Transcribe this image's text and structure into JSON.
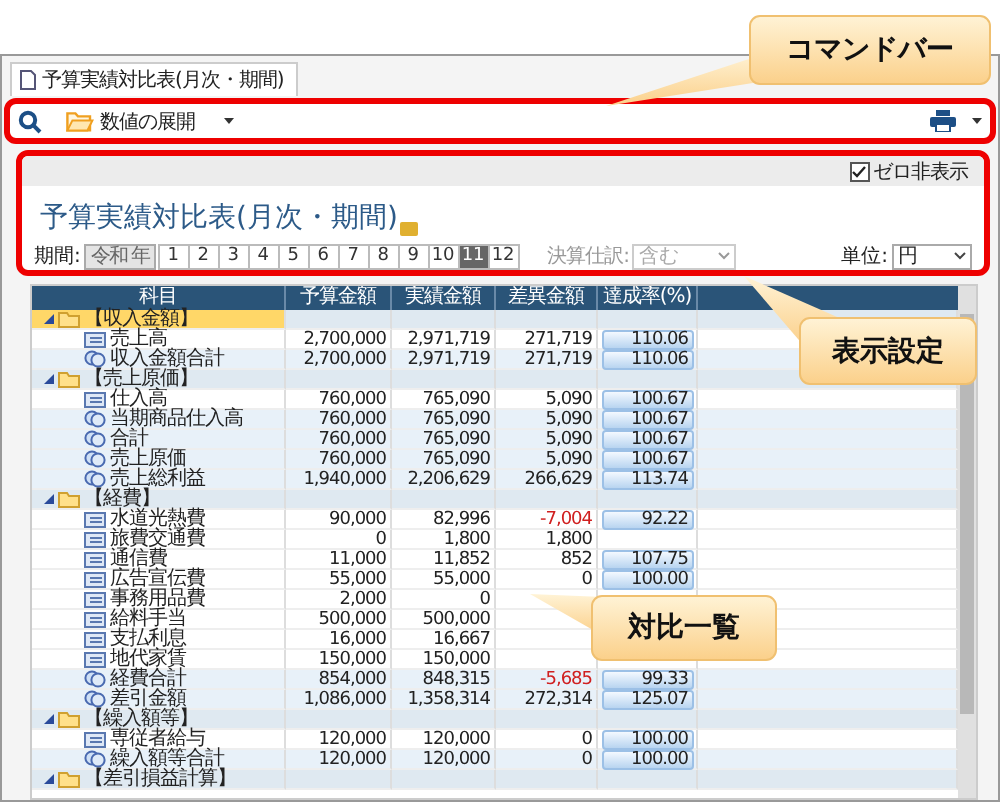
{
  "tab": {
    "label": "予算実績対比表(月次・期間)"
  },
  "command_bar": {
    "expand_button": "数値の展開"
  },
  "settings": {
    "zero_hide": {
      "label": "ゼロ非表示",
      "checked": true
    },
    "title": "予算実績対比表(月次・期間)",
    "period": {
      "label": "期間:",
      "year": "令和 年",
      "months": [
        {
          "label": "1",
          "selected": false
        },
        {
          "label": "2",
          "selected": false
        },
        {
          "label": "3",
          "selected": false
        },
        {
          "label": "4",
          "selected": false
        },
        {
          "label": "5",
          "selected": false
        },
        {
          "label": "6",
          "selected": false
        },
        {
          "label": "7",
          "selected": false
        },
        {
          "label": "8",
          "selected": false
        },
        {
          "label": "9",
          "selected": false
        },
        {
          "label": "10",
          "selected": false
        },
        {
          "label": "11",
          "selected": true
        },
        {
          "label": "12",
          "selected": false
        }
      ]
    },
    "closing": {
      "label": "決算仕訳:",
      "value": "含む",
      "disabled": true
    },
    "unit": {
      "label": "単位:",
      "value": "円"
    }
  },
  "table": {
    "columns": [
      "科目",
      "予算金額",
      "実績金額",
      "差異金額",
      "達成率(%)"
    ],
    "rows": [
      {
        "name": "【収入金額】",
        "kind": "group",
        "expanded": true,
        "selected": true
      },
      {
        "name": "売上高",
        "kind": "leaf",
        "selected": false,
        "budget": "2,700,000",
        "actual": "2,971,719",
        "diff": "271,719",
        "negative": false,
        "rate": "110.06"
      },
      {
        "name": "収入金額合計",
        "kind": "total",
        "selected": false,
        "budget": "2,700,000",
        "actual": "2,971,719",
        "diff": "271,719",
        "negative": false,
        "rate": "110.06"
      },
      {
        "name": "【売上原価】",
        "kind": "group",
        "expanded": true,
        "selected": false
      },
      {
        "name": "仕入高",
        "kind": "leaf",
        "selected": false,
        "budget": "760,000",
        "actual": "765,090",
        "diff": "5,090",
        "negative": false,
        "rate": "100.67"
      },
      {
        "name": "当期商品仕入高",
        "kind": "total",
        "selected": false,
        "budget": "760,000",
        "actual": "765,090",
        "diff": "5,090",
        "negative": false,
        "rate": "100.67"
      },
      {
        "name": "合計",
        "kind": "total",
        "selected": false,
        "budget": "760,000",
        "actual": "765,090",
        "diff": "5,090",
        "negative": false,
        "rate": "100.67"
      },
      {
        "name": "売上原価",
        "kind": "total",
        "selected": false,
        "budget": "760,000",
        "actual": "765,090",
        "diff": "5,090",
        "negative": false,
        "rate": "100.67"
      },
      {
        "name": "売上総利益",
        "kind": "total",
        "selected": false,
        "budget": "1,940,000",
        "actual": "2,206,629",
        "diff": "266,629",
        "negative": false,
        "rate": "113.74"
      },
      {
        "name": "【経費】",
        "kind": "group",
        "expanded": true,
        "selected": false
      },
      {
        "name": "水道光熱費",
        "kind": "leaf",
        "selected": false,
        "budget": "90,000",
        "actual": "82,996",
        "diff": "-7,004",
        "negative": true,
        "rate": "92.22"
      },
      {
        "name": "旅費交通費",
        "kind": "leaf",
        "selected": false,
        "budget": "0",
        "actual": "1,800",
        "diff": "1,800",
        "negative": false
      },
      {
        "name": "通信費",
        "kind": "leaf",
        "selected": false,
        "budget": "11,000",
        "actual": "11,852",
        "diff": "852",
        "negative": false,
        "rate": "107.75"
      },
      {
        "name": "広告宣伝費",
        "kind": "leaf",
        "selected": false,
        "budget": "55,000",
        "actual": "55,000",
        "diff": "0",
        "negative": false,
        "rate": "100.00"
      },
      {
        "name": "事務用品費",
        "kind": "leaf",
        "selected": false,
        "budget": "2,000",
        "actual": "0"
      },
      {
        "name": "給料手当",
        "kind": "leaf",
        "selected": false,
        "budget": "500,000",
        "actual": "500,000"
      },
      {
        "name": "支払利息",
        "kind": "leaf",
        "selected": false,
        "budget": "16,000",
        "actual": "16,667"
      },
      {
        "name": "地代家賃",
        "kind": "leaf",
        "selected": false,
        "budget": "150,000",
        "actual": "150,000"
      },
      {
        "name": "経費合計",
        "kind": "total",
        "selected": false,
        "budget": "854,000",
        "actual": "848,315",
        "diff": "-5,685",
        "negative": true,
        "rate": "99.33"
      },
      {
        "name": "差引金額",
        "kind": "total",
        "selected": false,
        "budget": "1,086,000",
        "actual": "1,358,314",
        "diff": "272,314",
        "negative": false,
        "rate": "125.07"
      },
      {
        "name": "【繰入額等】",
        "kind": "group",
        "expanded": true,
        "selected": false
      },
      {
        "name": "専従者給与",
        "kind": "leaf",
        "selected": false,
        "budget": "120,000",
        "actual": "120,000",
        "diff": "0",
        "negative": false,
        "rate": "100.00"
      },
      {
        "name": "繰入額等合計",
        "kind": "total",
        "selected": false,
        "budget": "120,000",
        "actual": "120,000",
        "diff": "0",
        "negative": false,
        "rate": "100.00"
      },
      {
        "name": "【差引損益計算】",
        "kind": "group",
        "expanded": true,
        "selected": false
      }
    ]
  },
  "callouts": [
    {
      "label": "コマンドバー"
    },
    {
      "label": "表示設定"
    },
    {
      "label": "対比一覧"
    }
  ]
}
